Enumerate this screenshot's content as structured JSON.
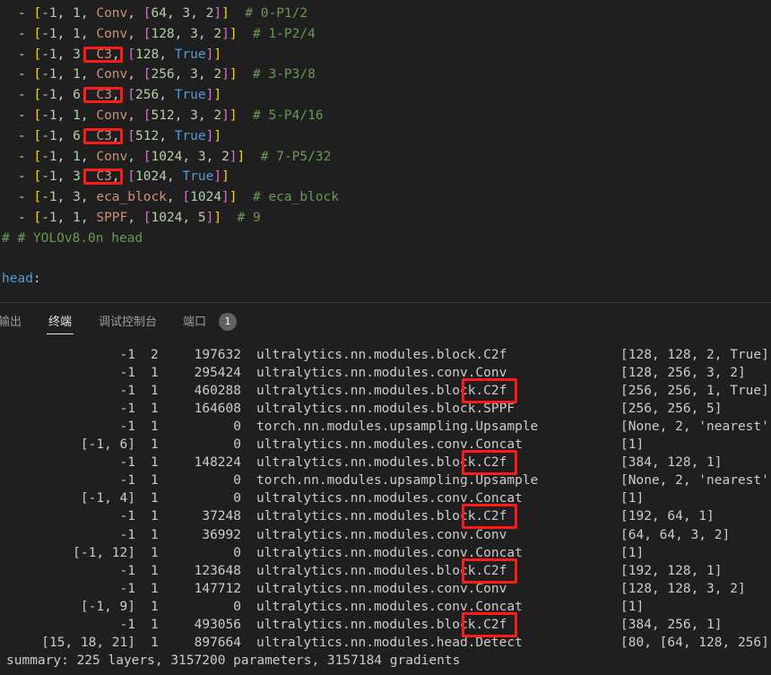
{
  "editor": {
    "backbone_lines": [
      {
        "from": "-1",
        "n": "1",
        "module": "Conv",
        "args_a": "64",
        "args_b": "3",
        "args_c": "2",
        "comment": "# 0-P1/2"
      },
      {
        "from": "-1",
        "n": "1",
        "module": "Conv",
        "args_a": "128",
        "args_b": "3",
        "args_c": "2",
        "comment": "# 1-P2/4"
      },
      {
        "from": "-1",
        "n": "3",
        "module": "C3",
        "args_a": "128",
        "args_b": "True",
        "args_c": "",
        "comment": ""
      },
      {
        "from": "-1",
        "n": "1",
        "module": "Conv",
        "args_a": "256",
        "args_b": "3",
        "args_c": "2",
        "comment": "# 3-P3/8"
      },
      {
        "from": "-1",
        "n": "6",
        "module": "C3",
        "args_a": "256",
        "args_b": "True",
        "args_c": "",
        "comment": ""
      },
      {
        "from": "-1",
        "n": "1",
        "module": "Conv",
        "args_a": "512",
        "args_b": "3",
        "args_c": "2",
        "comment": "# 5-P4/16"
      },
      {
        "from": "-1",
        "n": "6",
        "module": "C3",
        "args_a": "512",
        "args_b": "True",
        "args_c": "",
        "comment": ""
      },
      {
        "from": "-1",
        "n": "1",
        "module": "Conv",
        "args_a": "1024",
        "args_b": "3",
        "args_c": "2",
        "comment": "# 7-P5/32"
      },
      {
        "from": "-1",
        "n": "3",
        "module": "C3",
        "args_a": "1024",
        "args_b": "True",
        "args_c": "",
        "comment": ""
      },
      {
        "from": "-1",
        "n": "3",
        "module": "eca_block",
        "args_a": "1024",
        "args_b": "",
        "args_c": "",
        "comment": "# eca_block"
      },
      {
        "from": "-1",
        "n": "1",
        "module": "SPPF",
        "args_a": "1024",
        "args_b": "5",
        "args_c": "",
        "comment": "# 9"
      }
    ],
    "head_comment": "# # YOLOv8.0n head",
    "head_key": "head",
    "head_colon": ":"
  },
  "panel": {
    "tabs": [
      {
        "label": "输出"
      },
      {
        "label": "终端"
      },
      {
        "label": "调试控制台"
      },
      {
        "label": "端口"
      }
    ],
    "ports_badge": "1"
  },
  "terminal": {
    "rows": [
      {
        "from": "-1",
        "n": "2",
        "params": "197632",
        "module": "ultralytics.nn.modules.block.C2f",
        "args": "[128, 128, 2, True]"
      },
      {
        "from": "-1",
        "n": "1",
        "params": "295424",
        "module": "ultralytics.nn.modules.conv.Conv",
        "args": "[128, 256, 3, 2]"
      },
      {
        "from": "-1",
        "n": "1",
        "params": "460288",
        "module": "ultralytics.nn.modules.block.C2f",
        "args": "[256, 256, 1, True]"
      },
      {
        "from": "-1",
        "n": "1",
        "params": "164608",
        "module": "ultralytics.nn.modules.block.SPPF",
        "args": "[256, 256, 5]"
      },
      {
        "from": "-1",
        "n": "1",
        "params": "0",
        "module": "torch.nn.modules.upsampling.Upsample",
        "args": "[None, 2, 'nearest']"
      },
      {
        "from": "[-1, 6]",
        "n": "1",
        "params": "0",
        "module": "ultralytics.nn.modules.conv.Concat",
        "args": "[1]"
      },
      {
        "from": "-1",
        "n": "1",
        "params": "148224",
        "module": "ultralytics.nn.modules.block.C2f",
        "args": "[384, 128, 1]"
      },
      {
        "from": "-1",
        "n": "1",
        "params": "0",
        "module": "torch.nn.modules.upsampling.Upsample",
        "args": "[None, 2, 'nearest']"
      },
      {
        "from": "[-1, 4]",
        "n": "1",
        "params": "0",
        "module": "ultralytics.nn.modules.conv.Concat",
        "args": "[1]"
      },
      {
        "from": "-1",
        "n": "1",
        "params": "37248",
        "module": "ultralytics.nn.modules.block.C2f",
        "args": "[192, 64, 1]"
      },
      {
        "from": "-1",
        "n": "1",
        "params": "36992",
        "module": "ultralytics.nn.modules.conv.Conv",
        "args": "[64, 64, 3, 2]"
      },
      {
        "from": "[-1, 12]",
        "n": "1",
        "params": "0",
        "module": "ultralytics.nn.modules.conv.Concat",
        "args": "[1]"
      },
      {
        "from": "-1",
        "n": "1",
        "params": "123648",
        "module": "ultralytics.nn.modules.block.C2f",
        "args": "[192, 128, 1]"
      },
      {
        "from": "-1",
        "n": "1",
        "params": "147712",
        "module": "ultralytics.nn.modules.conv.Conv",
        "args": "[128, 128, 3, 2]"
      },
      {
        "from": "[-1, 9]",
        "n": "1",
        "params": "0",
        "module": "ultralytics.nn.modules.conv.Concat",
        "args": "[1]"
      },
      {
        "from": "-1",
        "n": "1",
        "params": "493056",
        "module": "ultralytics.nn.modules.block.C2f",
        "args": "[384, 256, 1]"
      },
      {
        "from": "[15, 18, 21]",
        "n": "1",
        "params": "897664",
        "module": "ultralytics.nn.modules.head.Detect",
        "args": "[80, [64, 128, 256]]"
      }
    ],
    "summary": "summary: 225 layers, 3157200 parameters, 3157184 gradients"
  },
  "colors": {
    "highlight": "#ff1a1a",
    "background": "#1f1f1f"
  }
}
